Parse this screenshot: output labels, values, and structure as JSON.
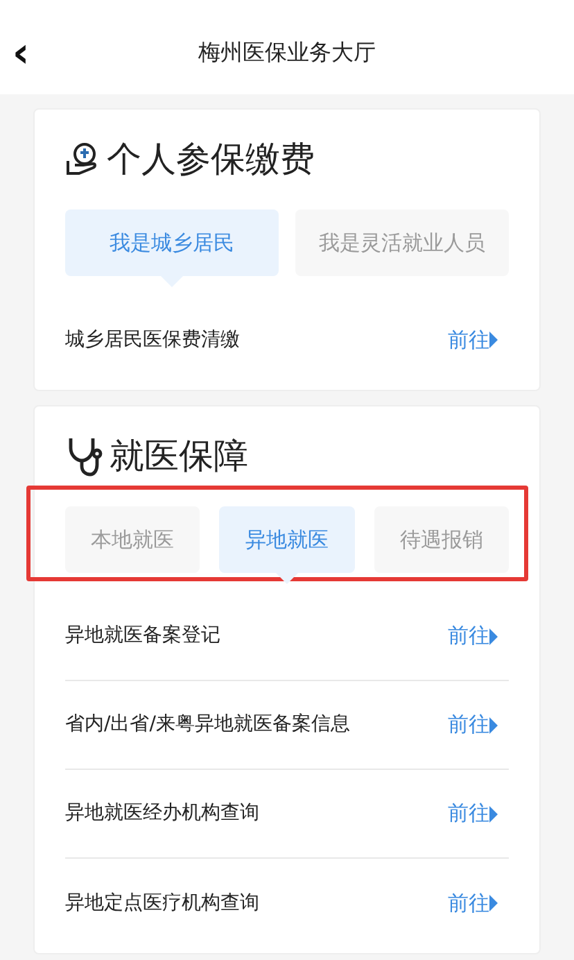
{
  "header": {
    "back": "‹",
    "title": "梅州医保业务大厅"
  },
  "sections": [
    {
      "title": "个人参保缴费",
      "kind": "payment",
      "highlighted": false,
      "tabs": [
        {
          "label": "我是城乡居民",
          "selected": true
        },
        {
          "label": "我是灵活就业人员",
          "selected": false
        }
      ],
      "rows": [
        {
          "label": "城乡居民医保费清缴",
          "action": "前往"
        }
      ]
    },
    {
      "title": "就医保障",
      "kind": "medical",
      "highlighted": true,
      "tabs": [
        {
          "label": "本地就医",
          "selected": false
        },
        {
          "label": "异地就医",
          "selected": true
        },
        {
          "label": "待遇报销",
          "selected": false
        }
      ],
      "rows": [
        {
          "label": "异地就医备案登记",
          "action": "前往"
        },
        {
          "label": "省内/出省/来粤异地就医备案信息",
          "action": "前往"
        },
        {
          "label": "异地就医经办机构查询",
          "action": "前往"
        },
        {
          "label": "异地定点医疗机构查询",
          "action": "前往"
        }
      ]
    }
  ]
}
